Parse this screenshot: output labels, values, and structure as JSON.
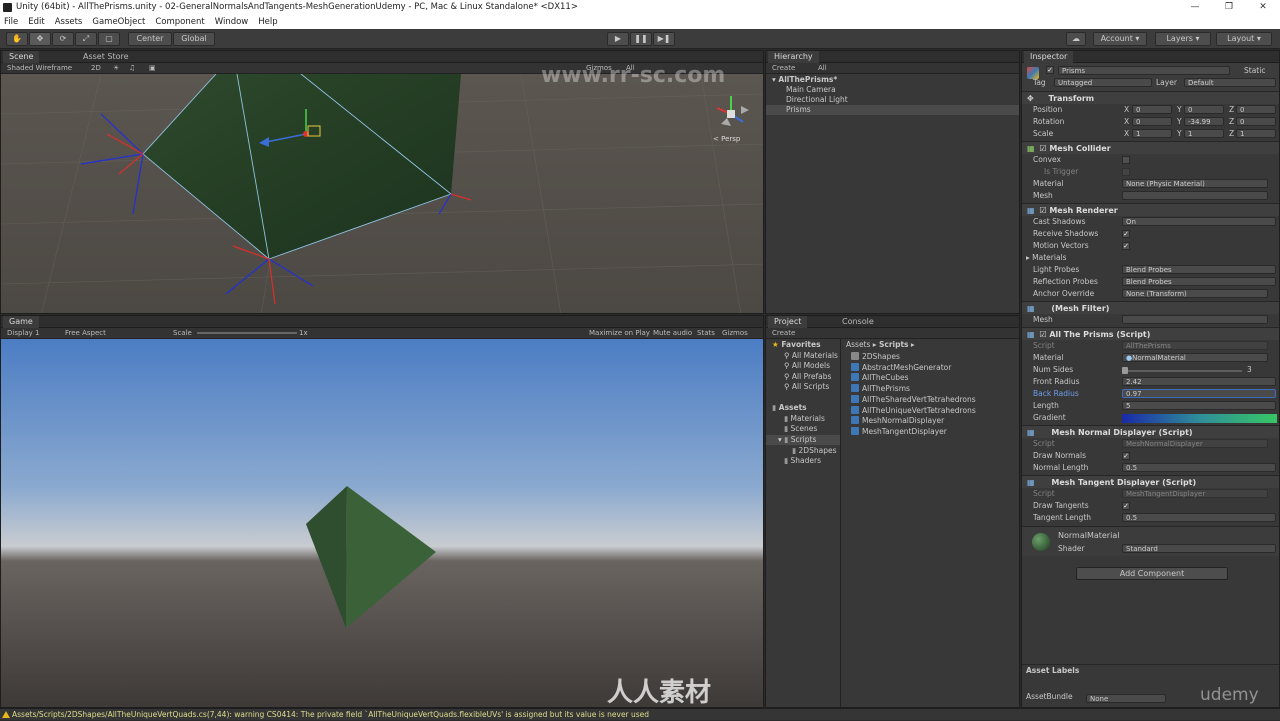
{
  "window": {
    "title": "Unity (64bit) - AllThePrisms.unity - 02-GeneralNormalsAndTangents-MeshGenerationUdemy - PC, Mac & Linux Standalone* <DX11>"
  },
  "menu": [
    "File",
    "Edit",
    "Assets",
    "GameObject",
    "Component",
    "Window",
    "Help"
  ],
  "toolbar": {
    "pivot": "Center",
    "space": "Global",
    "account": "Account",
    "layers": "Layers",
    "layout": "Layout"
  },
  "scene": {
    "tabs": [
      "Scene",
      "Asset Store"
    ],
    "shading": "Shaded Wireframe",
    "mode": "2D",
    "gizmos": "Gizmos",
    "search": "All",
    "persp": "Persp"
  },
  "game": {
    "tab": "Game",
    "display": "Display 1",
    "aspect": "Free Aspect",
    "scale_label": "Scale",
    "scale_value": "1x",
    "buttons": [
      "Maximize on Play",
      "Mute audio",
      "Stats",
      "Gizmos"
    ]
  },
  "hierarchy": {
    "tab": "Hierarchy",
    "create": "Create",
    "search": "All",
    "scene_name": "AllThePrisms*",
    "items": [
      "Main Camera",
      "Directional Light",
      "Prisms"
    ]
  },
  "project": {
    "tabs": [
      "Project",
      "Console"
    ],
    "create": "Create",
    "favorites_label": "Favorites",
    "favorites": [
      "All Materials",
      "All Models",
      "All Prefabs",
      "All Scripts"
    ],
    "assets_label": "Assets",
    "assets_tree": [
      "Materials",
      "Scenes",
      "Scripts",
      "2DShapes",
      "Shaders"
    ],
    "breadcrumb_root": "Assets",
    "breadcrumb_leaf": "Scripts",
    "files": [
      "2DShapes",
      "AbstractMeshGenerator",
      "AllTheCubes",
      "AllThePrisms",
      "AllTheSharedVertTetrahedrons",
      "AllTheUniqueVertTetrahedrons",
      "MeshNormalDisplayer",
      "MeshTangentDisplayer"
    ]
  },
  "inspector": {
    "tab": "Inspector",
    "object_name": "Prisms",
    "static": "Static",
    "tag_label": "Tag",
    "tag_value": "Untagged",
    "layer_label": "Layer",
    "layer_value": "Default",
    "transform": {
      "title": "Transform",
      "position_label": "Position",
      "rotation_label": "Rotation",
      "scale_label": "Scale",
      "position": [
        "0",
        "0",
        "0"
      ],
      "rotation": [
        "0",
        "-34.99",
        "0"
      ],
      "scale": [
        "1",
        "1",
        "1"
      ]
    },
    "mesh_collider": {
      "title": "Mesh Collider",
      "convex": "Convex",
      "is_trigger": "Is Trigger",
      "material_label": "Material",
      "material_value": "None (Physic Material)",
      "mesh_label": "Mesh"
    },
    "mesh_renderer": {
      "title": "Mesh Renderer",
      "cast_shadows": "Cast Shadows",
      "cast_shadows_value": "On",
      "receive_shadows": "Receive Shadows",
      "motion_vectors": "Motion Vectors",
      "materials": "Materials",
      "light_probes": "Light Probes",
      "light_probes_value": "Blend Probes",
      "reflection_probes": "Reflection Probes",
      "reflection_probes_value": "Blend Probes",
      "anchor_override": "Anchor Override",
      "anchor_override_value": "None (Transform)"
    },
    "mesh_filter": {
      "title": "(Mesh Filter)",
      "mesh_label": "Mesh"
    },
    "prisms_script": {
      "title": "All The Prisms (Script)",
      "script_label": "Script",
      "script_value": "AllThePrisms",
      "material_label": "Material",
      "material_value": "NormalMaterial",
      "num_sides_label": "Num Sides",
      "num_sides_value": "3",
      "front_radius_label": "Front Radius",
      "front_radius_value": "2.42",
      "back_radius_label": "Back Radius",
      "back_radius_value": "0.97",
      "length_label": "Length",
      "length_value": "5",
      "gradient_label": "Gradient"
    },
    "normal_displayer": {
      "title": "Mesh Normal Displayer (Script)",
      "script_label": "Script",
      "script_value": "MeshNormalDisplayer",
      "draw_label": "Draw Normals",
      "length_label": "Normal Length",
      "length_value": "0.5"
    },
    "tangent_displayer": {
      "title": "Mesh Tangent Displayer (Script)",
      "script_label": "Script",
      "script_value": "MeshTangentDisplayer",
      "draw_label": "Draw Tangents",
      "length_label": "Tangent Length",
      "length_value": "0.5"
    },
    "material": {
      "name": "NormalMaterial",
      "shader_label": "Shader",
      "shader_value": "Standard"
    },
    "add_component": "Add Component",
    "asset_labels": "Asset Labels",
    "asset_bundle_label": "AssetBundle",
    "asset_bundle_value": "None"
  },
  "status": {
    "message": "Assets/Scripts/2DShapes/AllTheUniqueVertQuads.cs(7,44): warning CS0414: The private field `AllTheUniqueVertQuads.flexibleUVs' is assigned but its value is never used"
  },
  "watermarks": {
    "top": "www.rr-sc.com",
    "bottom": "人人素材",
    "brand": "udemy"
  },
  "colors": {
    "accent_blue": "#3d6dbd",
    "warning_yellow": "#e5b71a",
    "gradient_start": "#1a2aa8",
    "gradient_end": "#37c764"
  }
}
